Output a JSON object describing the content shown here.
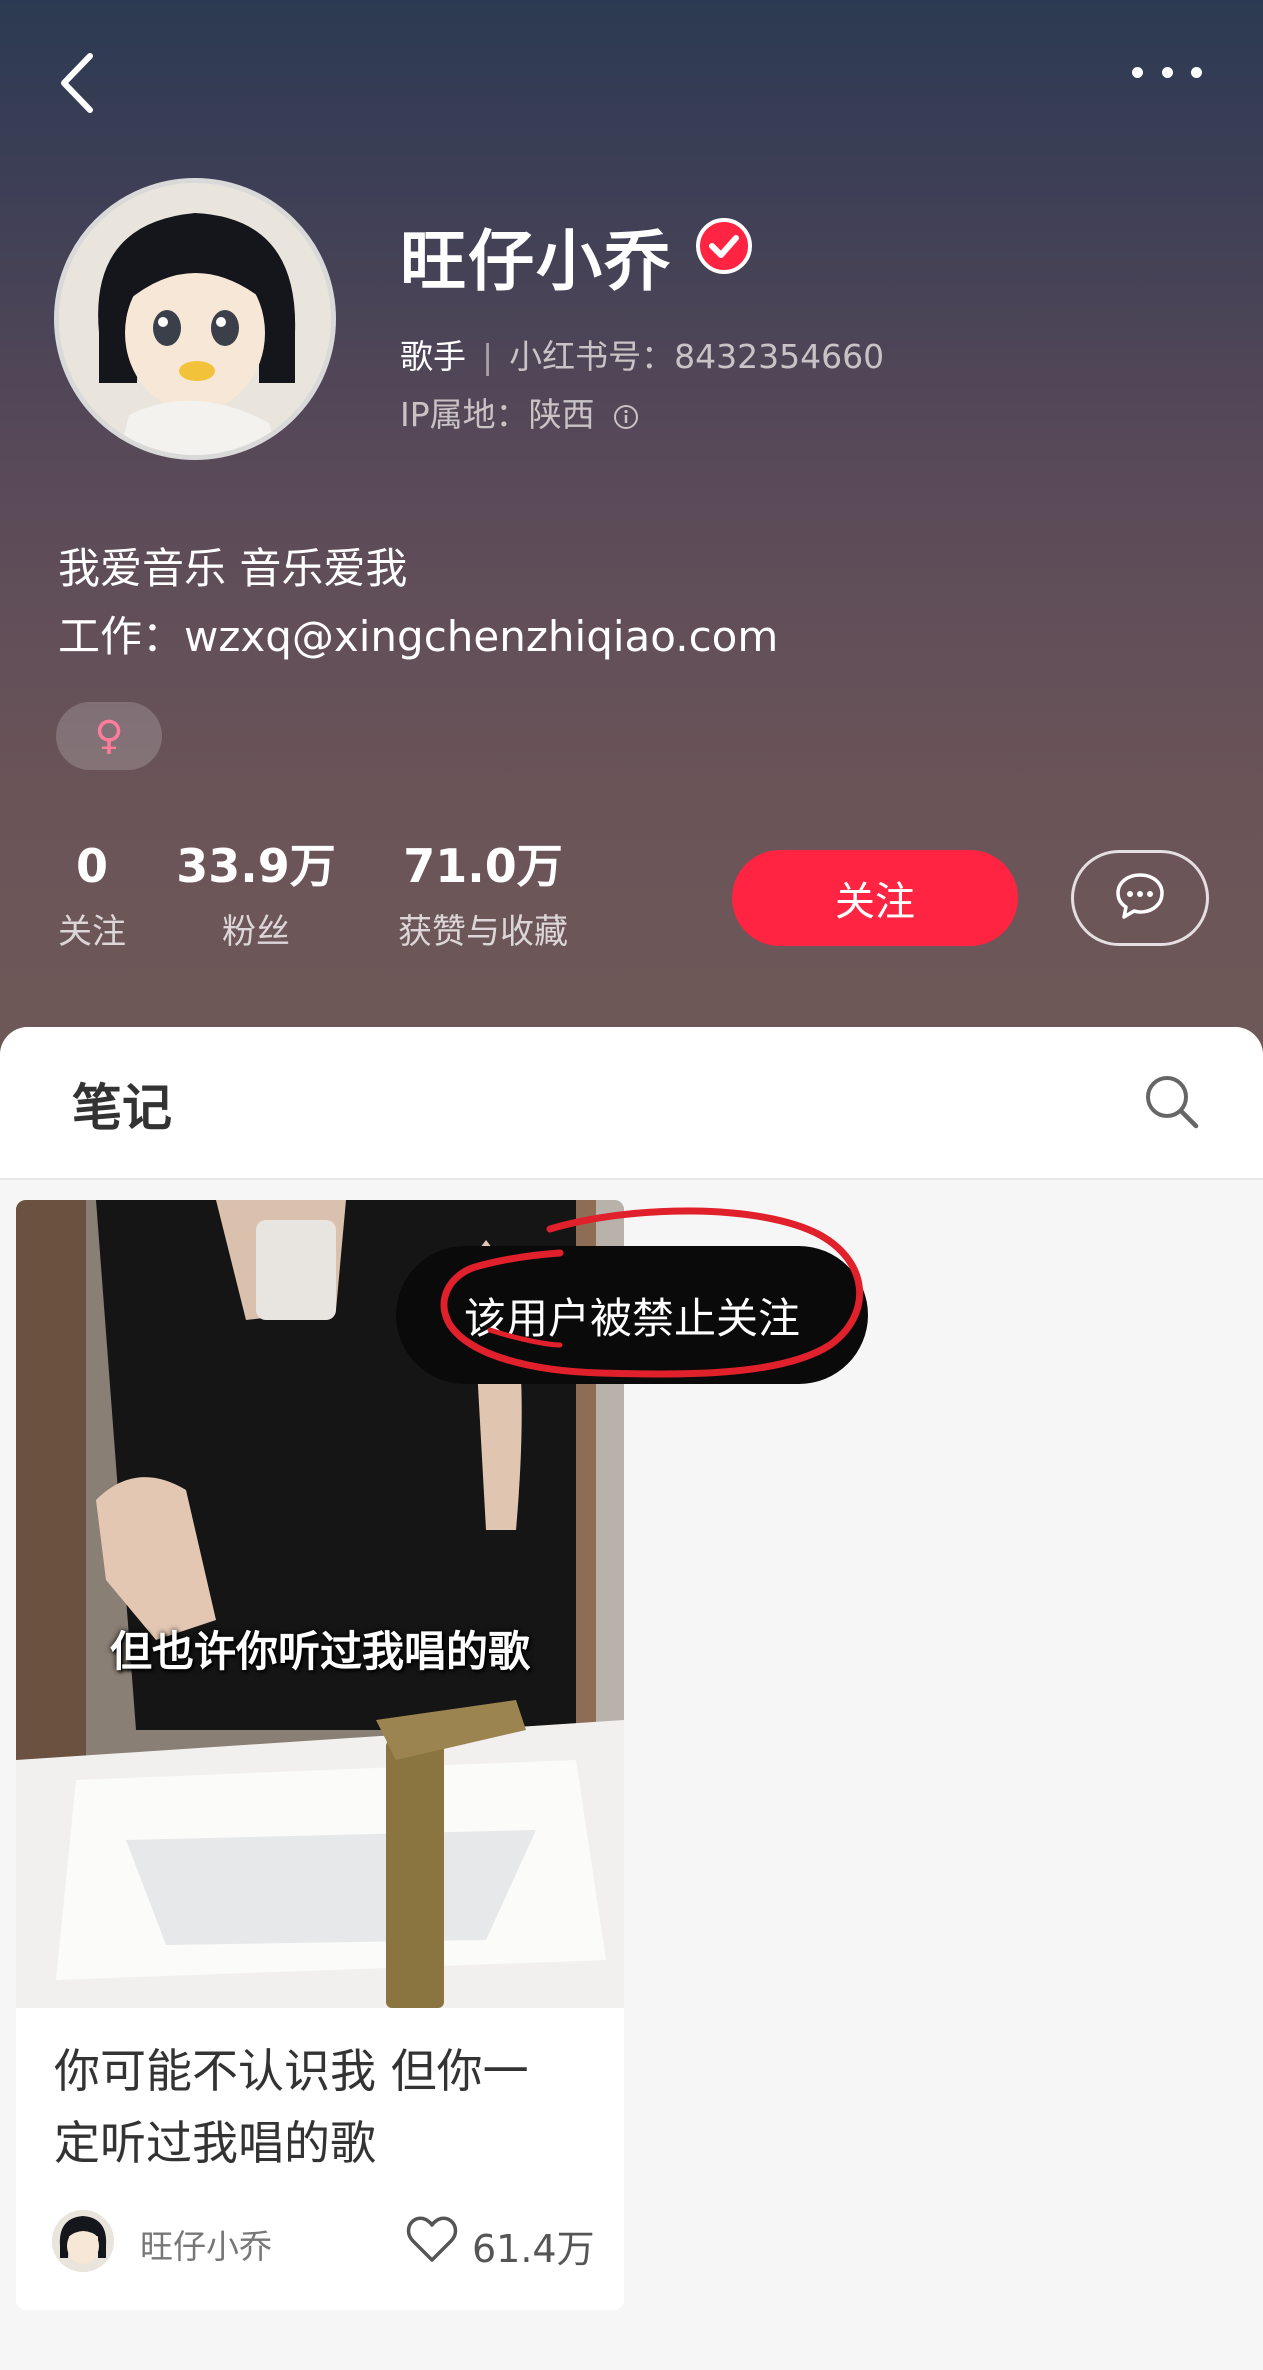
{
  "profile": {
    "name": "旺仔小乔",
    "role": "歌手",
    "id_text": "小红书号：8432354660",
    "ip_text": "IP属地：陕西",
    "bio_line1": "我爱音乐 音乐爱我",
    "bio_line2": "工作：wzxq@xingchenzhiqiao.com",
    "gender_symbol": "♀"
  },
  "stats": [
    {
      "value": "0",
      "label": "关注"
    },
    {
      "value": "33.9万",
      "label": "粉丝"
    },
    {
      "value": "71.0万",
      "label": "获赞与收藏"
    }
  ],
  "actions": {
    "follow_label": "关注"
  },
  "tabs": {
    "notes_label": "笔记"
  },
  "note": {
    "image_caption": "但也许你听过我唱的歌",
    "title_line1": "你可能不认识我 但你一",
    "title_line2": "定听过我唱的歌",
    "author": "旺仔小乔",
    "likes": "61.4万"
  },
  "toast": {
    "message": "该用户被禁止关注"
  },
  "colors": {
    "accent": "#ff2442",
    "annotation_circle": "#e0202a"
  },
  "icons": [
    "back-arrow-icon",
    "more-dots-icon",
    "verified-check-icon",
    "info-icon",
    "female-icon",
    "chat-bubble-icon",
    "search-icon",
    "heart-icon"
  ]
}
